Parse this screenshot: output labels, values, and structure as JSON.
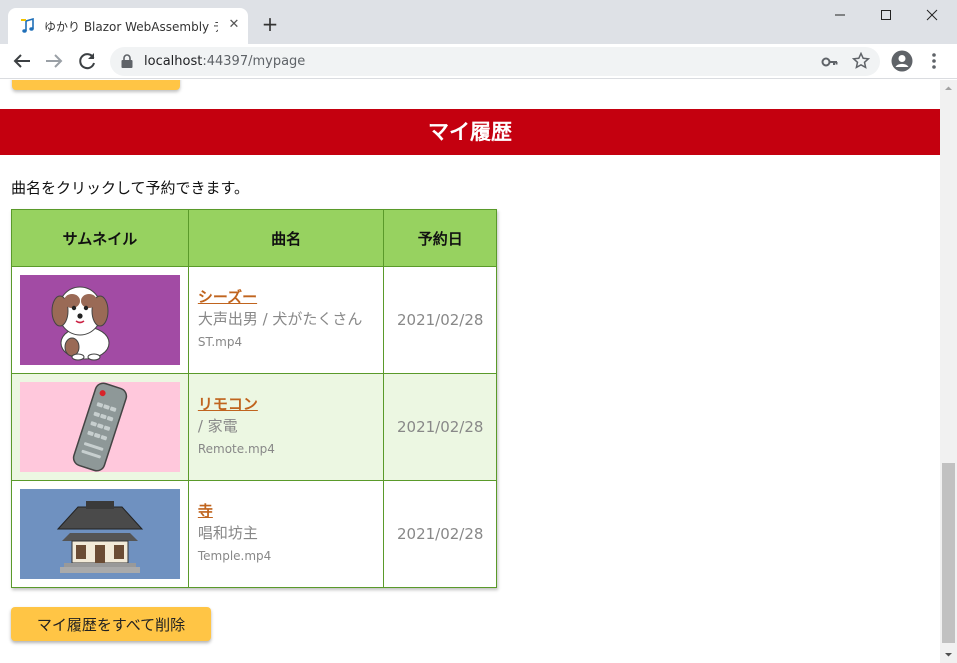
{
  "browser": {
    "tab_title": "ゆかり Blazor WebAssembly デモ",
    "tab_close": "✕",
    "new_tab": "+",
    "url_host": "localhost",
    "url_rest": ":44397/mypage"
  },
  "page": {
    "header": "マイ履歴",
    "instructions": "曲名をクリックして予約できます。",
    "columns": [
      "サムネイル",
      "曲名",
      "予約日"
    ],
    "rows": [
      {
        "title": "シーズー",
        "artist": "大声出男 / 犬がたくさん",
        "file": "ST.mp4",
        "date": "2021/02/28",
        "thumb_bg": "#a24ba4",
        "thumb_icon": "dog-icon"
      },
      {
        "title": "リモコン",
        "artist": "/ 家電",
        "file": "Remote.mp4",
        "date": "2021/02/28",
        "thumb_bg": "#ffc8dc",
        "thumb_icon": "remote-control-icon"
      },
      {
        "title": "寺",
        "artist": "唱和坊主",
        "file": "Temple.mp4",
        "date": "2021/02/28",
        "thumb_bg": "#6f91c0",
        "thumb_icon": "temple-icon"
      }
    ],
    "delete_all_button": "マイ履歴をすべて削除"
  },
  "colors": {
    "header_bg": "#c4000f",
    "table_header_bg": "#97d260",
    "button_bg": "#ffc545",
    "link": "#c0641e"
  }
}
